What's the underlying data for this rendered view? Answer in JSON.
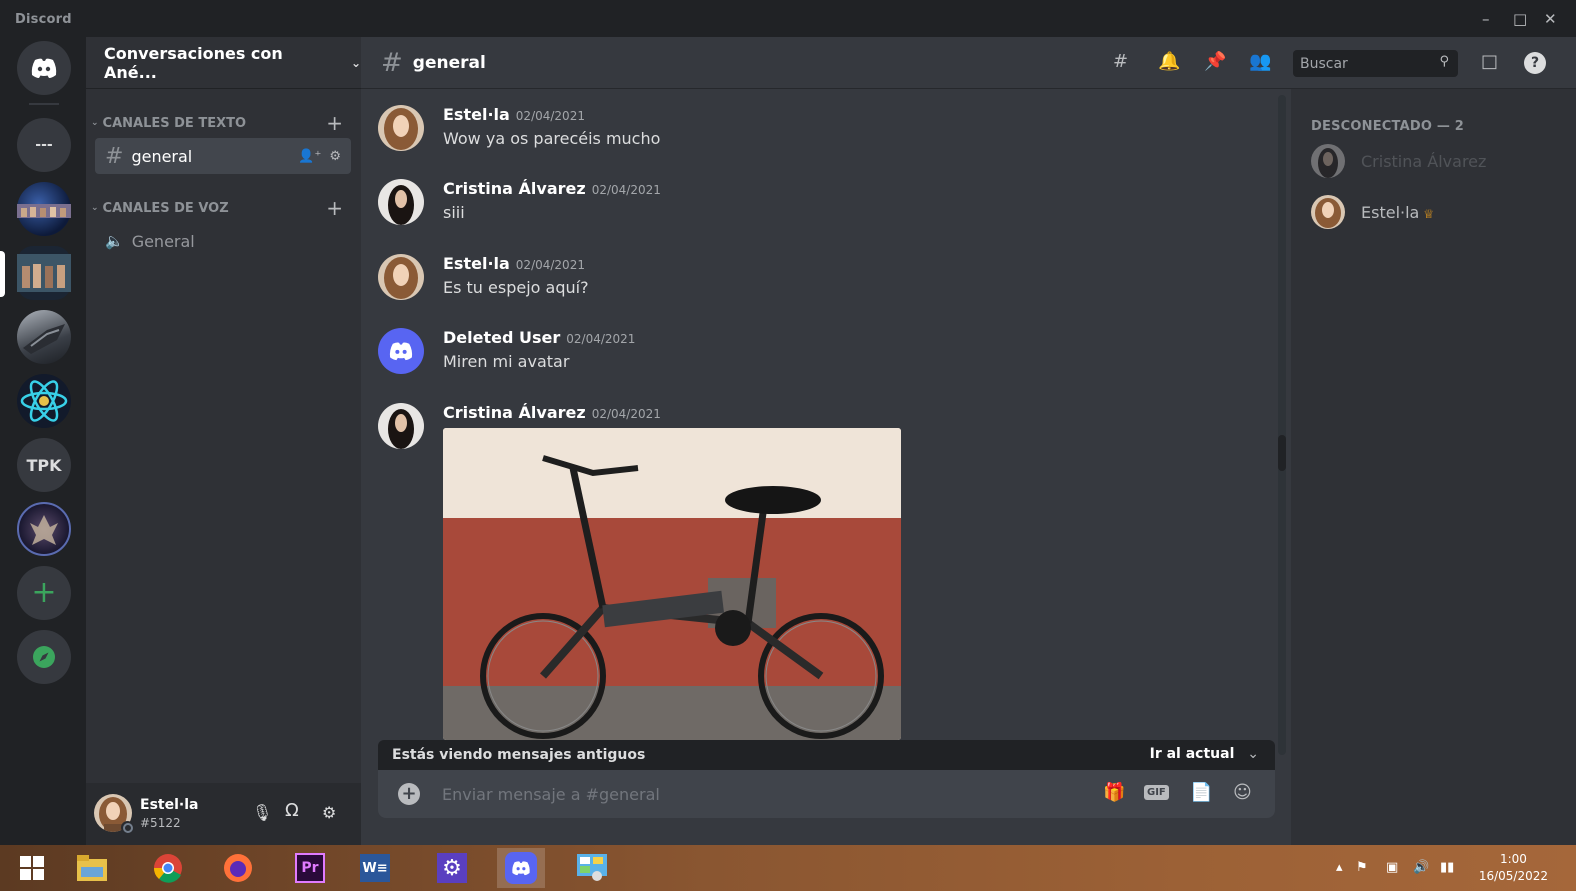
{
  "app": {
    "title": "Discord"
  },
  "window_controls": {
    "minimize": "–",
    "maximize": "□",
    "close": "✕"
  },
  "servers": [
    {
      "name": "home",
      "icon": "discord-logo-icon"
    },
    {
      "name": "dm-server",
      "label": "---"
    },
    {
      "name": "server-photo-1",
      "icon": "server-photo"
    },
    {
      "name": "server-photo-2",
      "icon": "server-photo",
      "active": true
    },
    {
      "name": "server-spaceship",
      "icon": "server-photo"
    },
    {
      "name": "server-atom",
      "icon": "atom-icon"
    },
    {
      "name": "server-tpk",
      "label": "TPK"
    },
    {
      "name": "server-photo-3",
      "icon": "server-photo"
    },
    {
      "name": "add-server",
      "icon": "plus-icon"
    },
    {
      "name": "explore",
      "icon": "compass-icon"
    }
  ],
  "guild": {
    "name": "Conversaciones con Ané..."
  },
  "categories": {
    "text": "CANALES DE TEXTO",
    "voice": "CANALES DE VOZ"
  },
  "channels": {
    "text": [
      {
        "name": "general",
        "active": true
      }
    ],
    "voice": [
      {
        "name": "General"
      }
    ]
  },
  "user": {
    "name": "Estel·la",
    "tag": "#5122"
  },
  "channel_header": {
    "name": "general",
    "search_placeholder": "Buscar"
  },
  "messages": [
    {
      "author": "Estel·la",
      "timestamp": "02/04/2021",
      "text": "Wow ya os parecéis mucho"
    },
    {
      "author": "Cristina Álvarez",
      "timestamp": "02/04/2021",
      "text": "siii"
    },
    {
      "author": "Estel·la",
      "timestamp": "02/04/2021",
      "text": "Es tu espejo aquí?"
    },
    {
      "author": "Deleted User",
      "timestamp": "02/04/2021",
      "text": "Miren mi avatar"
    },
    {
      "author": "Cristina Álvarez",
      "timestamp": "02/04/2021",
      "text": ""
    }
  ],
  "banner": {
    "text": "Estás viendo mensajes antiguos",
    "jump": "Ir al actual"
  },
  "composer": {
    "placeholder": "Enviar mensaje a #general",
    "gif": "GIF"
  },
  "members": {
    "section": "DESCONECTADO — 2",
    "list": [
      {
        "name": "Cristina Álvarez"
      },
      {
        "name": "Estel·la",
        "owner": true
      }
    ]
  },
  "taskbar": {
    "apps": [
      "windows-start",
      "file-explorer",
      "chrome",
      "firefox",
      "premiere-pro",
      "word",
      "settings",
      "discord",
      "control-panel"
    ],
    "clock_time": "1:00",
    "clock_date": "16/05/2022"
  },
  "colors": {
    "blurple": "#5865f2",
    "green": "#3ba55d",
    "bg_main": "#36393f",
    "bg_side": "#2f3136",
    "bg_rail": "#202225"
  }
}
